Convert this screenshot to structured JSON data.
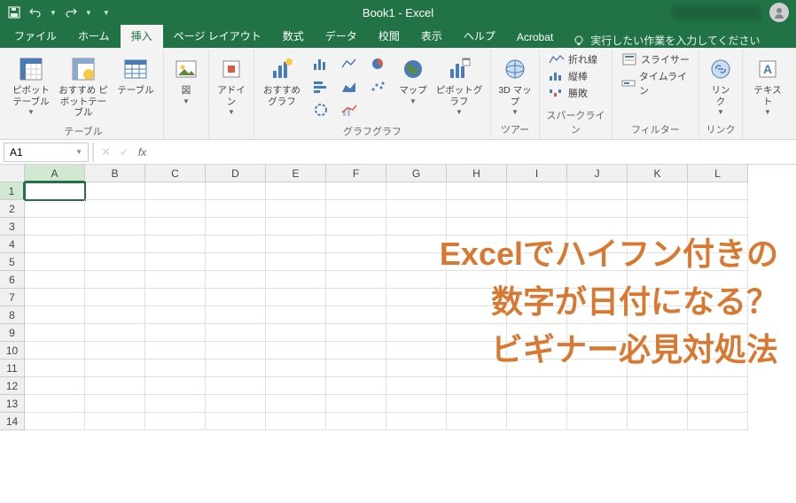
{
  "title": "Book1  -  Excel",
  "tabs": {
    "file": "ファイル",
    "home": "ホーム",
    "insert": "挿入",
    "pagelayout": "ページ レイアウト",
    "formulas": "数式",
    "data": "データ",
    "review": "校閲",
    "view": "表示",
    "help": "ヘルプ",
    "acrobat": "Acrobat"
  },
  "tellme": "実行したい作業を入力してください",
  "ribbon": {
    "tables": {
      "label": "テーブル",
      "pivot": "ピボット\nテーブル",
      "recpivot": "おすすめ\nピボットテーブル",
      "table": "テーブル"
    },
    "illustrations": {
      "label": "図",
      "shapes": "図"
    },
    "addins": {
      "label": "アドイ\nン"
    },
    "charts": {
      "label": "グラフ",
      "rec": "おすすめ\nグラフ",
      "map": "マップ",
      "pivotchart": "ピボットグラフ"
    },
    "tours": {
      "label": "ツアー",
      "map3d": "3D\nマップ"
    },
    "sparklines": {
      "label": "スパークライン",
      "line": "折れ線",
      "column": "縦棒",
      "winloss": "勝敗"
    },
    "filters": {
      "label": "フィルター",
      "slicer": "スライサー",
      "timeline": "タイムライン"
    },
    "links": {
      "label": "リンク",
      "link": "リン\nク"
    },
    "text": {
      "label": "テキスト",
      "text": "テキスト"
    }
  },
  "namebox": "A1",
  "columns": [
    "A",
    "B",
    "C",
    "D",
    "E",
    "F",
    "G",
    "H",
    "I",
    "J",
    "K",
    "L"
  ],
  "rows": [
    "1",
    "2",
    "3",
    "4",
    "5",
    "6",
    "7",
    "8",
    "9",
    "10",
    "11",
    "12",
    "13",
    "14"
  ],
  "overlay": {
    "l1": "Excelでハイフン付きの",
    "l2": "数字が日付になる？",
    "l3": "ビギナー必見対処法"
  }
}
